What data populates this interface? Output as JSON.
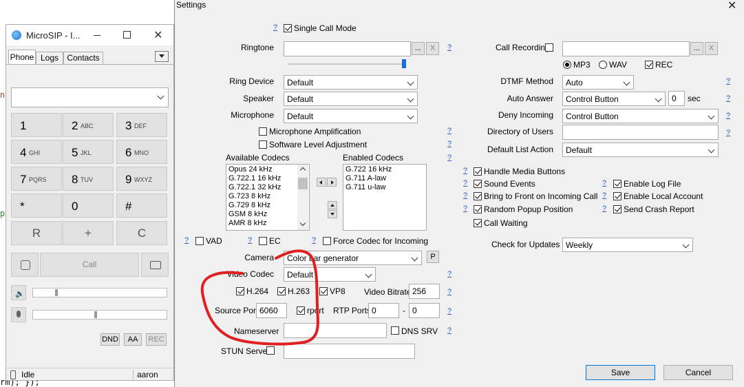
{
  "background_code": {
    "top": "nc",
    "mid": "pe",
    "bottom": "rm); });"
  },
  "microsip": {
    "title": "MicroSIP - I...",
    "tabs": [
      "Phone",
      "Logs",
      "Contacts"
    ],
    "keys": [
      {
        "d": "1",
        "s": ""
      },
      {
        "d": "2",
        "s": "ABC"
      },
      {
        "d": "3",
        "s": "DEF"
      },
      {
        "d": "4",
        "s": "GHI"
      },
      {
        "d": "5",
        "s": "JKL"
      },
      {
        "d": "6",
        "s": "MNO"
      },
      {
        "d": "7",
        "s": "PQRS"
      },
      {
        "d": "8",
        "s": "TUV"
      },
      {
        "d": "9",
        "s": "WXYZ"
      },
      {
        "d": "*",
        "s": ""
      },
      {
        "d": "0",
        "s": ""
      },
      {
        "d": "#",
        "s": ""
      }
    ],
    "ctrl_keys": [
      "R",
      "+",
      "C"
    ],
    "call_label": "Call",
    "flag_buttons": [
      "DND",
      "AA",
      "REC"
    ],
    "status": "Idle",
    "user": "aaron"
  },
  "settings": {
    "title": "Settings",
    "help": "?",
    "single_call_mode": "Single Call Mode",
    "ringtone_label": "Ringtone",
    "browse": "...",
    "clear": "X",
    "ring_device_label": "Ring Device",
    "ring_device": "Default",
    "speaker_label": "Speaker",
    "speaker": "Default",
    "microphone_label": "Microphone",
    "microphone": "Default",
    "mic_amp": "Microphone Amplification",
    "sw_level": "Software Level Adjustment",
    "available_codecs_label": "Available Codecs",
    "available_codecs": [
      "Opus 24 kHz",
      "G.722.1 16 kHz",
      "G.722.1 32 kHz",
      "G.723 8 kHz",
      "G.729 8 kHz",
      "GSM 8 kHz",
      "AMR 8 kHz"
    ],
    "enabled_codecs_label": "Enabled Codecs",
    "enabled_codecs": [
      "G.722 16 kHz",
      "G.711 A-law",
      "G.711 u-law"
    ],
    "vad": "VAD",
    "ec": "EC",
    "force_codec": "Force Codec for Incoming",
    "camera_label": "Camera",
    "camera": "Color bar generator",
    "camera_p": "P",
    "video_codec_label": "Video Codec",
    "video_codec": "Default",
    "h264": "H.264",
    "h263": "H.263",
    "vp8": "VP8",
    "video_bitrate_label": "Video Bitrate",
    "video_bitrate": "256",
    "source_port_label": "Source Port",
    "source_port": "6060",
    "rport": "rport",
    "rtp_ports_label": "RTP Ports",
    "rtp_from": "0",
    "rtp_dash": "-",
    "rtp_to": "0",
    "nameserver_label": "Nameserver",
    "dns_srv": "DNS SRV",
    "stun_label": "STUN Server",
    "call_recording_label": "Call Recording",
    "mp3": "MP3",
    "wav": "WAV",
    "rec": "REC",
    "dtmf_label": "DTMF Method",
    "dtmf": "Auto",
    "auto_answer_label": "Auto Answer",
    "auto_answer": "Control Button",
    "auto_answer_sec": "0",
    "sec": "sec",
    "deny_incoming_label": "Deny Incoming",
    "deny_incoming": "Control Button",
    "directory_label": "Directory of Users",
    "default_list_label": "Default List Action",
    "default_list": "Default",
    "handle_media": "Handle Media Buttons",
    "sound_events": "Sound Events",
    "bring_front": "Bring to Front on Incoming Call",
    "random_popup": "Random Popup Position",
    "call_waiting": "Call Waiting",
    "enable_log": "Enable Log File",
    "enable_local": "Enable Local Account",
    "send_crash": "Send Crash Report",
    "check_updates_label": "Check for Updates",
    "check_updates": "Weekly",
    "save": "Save",
    "cancel": "Cancel"
  },
  "annotation_color": "#e02020"
}
